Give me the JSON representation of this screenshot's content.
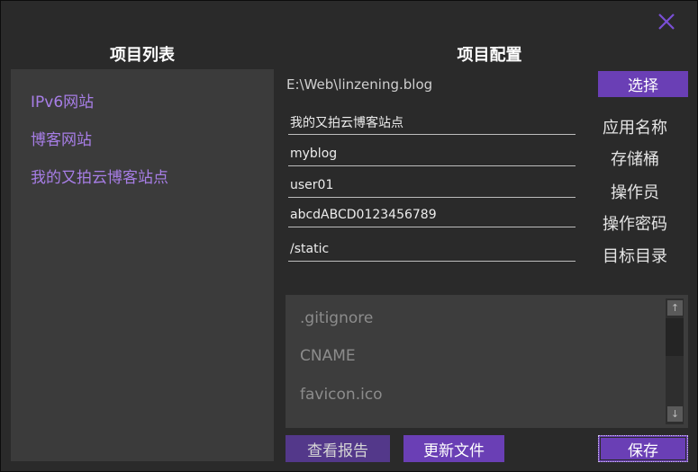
{
  "colors": {
    "accent": "#6a3fb5",
    "link": "#a77ee6",
    "close": "#7a4fd6"
  },
  "close_icon": "close-icon",
  "left": {
    "title": "项目列表",
    "projects": [
      "IPv6网站",
      "博客网站",
      "我的又拍云博客站点"
    ]
  },
  "right": {
    "title": "项目配置",
    "path": "E:\\Web\\linzening.blog",
    "select_label": "选择",
    "fields": [
      {
        "value": "我的又拍云博客站点",
        "label": "应用名称"
      },
      {
        "value": "myblog",
        "label": "存储桶"
      },
      {
        "value": "user01",
        "label": "操作员"
      },
      {
        "value": "abcdABCD0123456789",
        "label": "操作密码"
      },
      {
        "value": "/static",
        "label": "目标目录"
      }
    ],
    "files": [
      ".gitignore",
      "CNAME",
      "favicon.ico"
    ],
    "scroll_up_icon": "arrow-up-icon",
    "scroll_down_icon": "arrow-down-icon"
  },
  "buttons": {
    "report": "查看报告",
    "update": "更新文件",
    "save": "保存"
  }
}
